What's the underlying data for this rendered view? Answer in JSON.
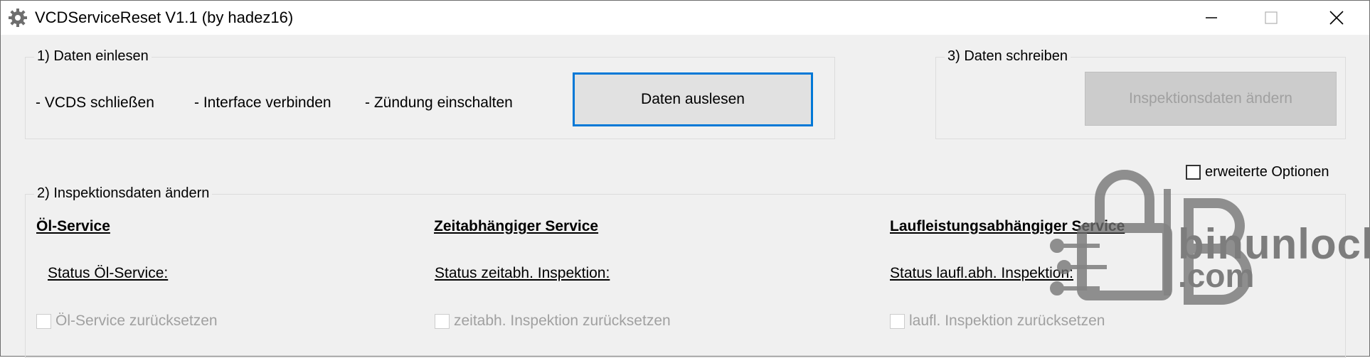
{
  "window": {
    "title": "VCDServiceReset V1.1 (by hadez16)",
    "icon": "gear-icon"
  },
  "group1": {
    "label": "1) Daten einlesen",
    "steps": [
      "- VCDS schließen",
      "- Interface verbinden",
      "- Zündung einschalten"
    ],
    "read_button": "Daten auslesen"
  },
  "group3": {
    "label": "3) Daten schreiben",
    "write_button": "Inspektionsdaten ändern"
  },
  "extended_options": {
    "label": "erweiterte Optionen",
    "checked": false
  },
  "group2": {
    "label": "2) Inspektionsdaten ändern",
    "columns": [
      {
        "heading": "Öl-Service",
        "status_label": "Status Öl-Service:",
        "reset_label": "Öl-Service zurücksetzen"
      },
      {
        "heading": "Zeitabhängiger Service",
        "status_label": "Status zeitabh. Inspektion:",
        "reset_label": "zeitabh. Inspektion zurücksetzen"
      },
      {
        "heading": "Laufleistungsabhängiger Service",
        "status_label": "Status laufl.abh. Inspektion:",
        "reset_label": "laufl. Inspektion zurücksetzen"
      }
    ]
  },
  "watermark": {
    "line1": "binunlock",
    "line2": ".com",
    "color": "#7d7d7d"
  }
}
